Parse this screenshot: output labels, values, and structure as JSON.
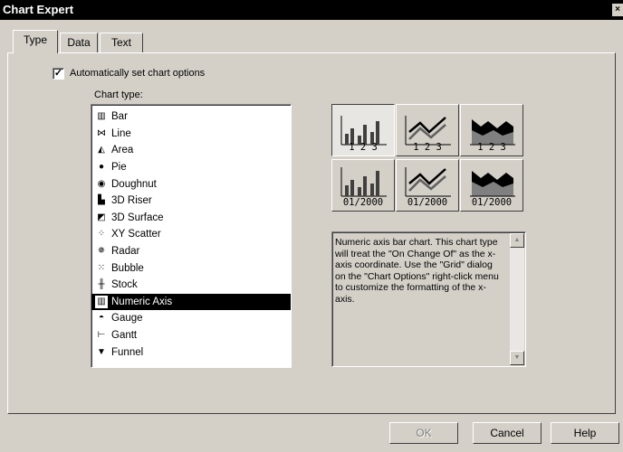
{
  "window": {
    "title": "Chart Expert",
    "close_glyph": "×"
  },
  "tabs": [
    {
      "label": "Type",
      "active": true
    },
    {
      "label": "Data",
      "active": false
    },
    {
      "label": "Text",
      "active": false
    }
  ],
  "auto_options": {
    "label": "Automatically set chart options",
    "checked": true,
    "check_glyph": "✓"
  },
  "chart_type_label": "Chart type:",
  "chart_types": [
    {
      "label": "Bar",
      "icon": "bar-chart-icon",
      "glyph": "▥"
    },
    {
      "label": "Line",
      "icon": "line-chart-icon",
      "glyph": "⋈"
    },
    {
      "label": "Area",
      "icon": "area-chart-icon",
      "glyph": "◭"
    },
    {
      "label": "Pie",
      "icon": "pie-chart-icon",
      "glyph": "●"
    },
    {
      "label": "Doughnut",
      "icon": "doughnut-chart-icon",
      "glyph": "◉"
    },
    {
      "label": "3D Riser",
      "icon": "3d-riser-icon",
      "glyph": "▙"
    },
    {
      "label": "3D Surface",
      "icon": "3d-surface-icon",
      "glyph": "◩"
    },
    {
      "label": "XY Scatter",
      "icon": "xy-scatter-icon",
      "glyph": "⁘"
    },
    {
      "label": "Radar",
      "icon": "radar-chart-icon",
      "glyph": "✵"
    },
    {
      "label": "Bubble",
      "icon": "bubble-chart-icon",
      "glyph": "⁙"
    },
    {
      "label": "Stock",
      "icon": "stock-chart-icon",
      "glyph": "╫"
    },
    {
      "label": "Numeric Axis",
      "icon": "numeric-axis-icon",
      "glyph": "▥",
      "selected": true
    },
    {
      "label": "Gauge",
      "icon": "gauge-chart-icon",
      "glyph": "◓"
    },
    {
      "label": "Gantt",
      "icon": "gantt-chart-icon",
      "glyph": "⊢"
    },
    {
      "label": "Funnel",
      "icon": "funnel-chart-icon",
      "glyph": "▼"
    }
  ],
  "subtypes": [
    {
      "name": "bar",
      "label": "1 2 3",
      "selected": true
    },
    {
      "name": "line",
      "label": "1 2 3",
      "selected": false
    },
    {
      "name": "area",
      "label": "1 2 3",
      "selected": false
    },
    {
      "name": "bar",
      "label": "01/2000",
      "selected": false
    },
    {
      "name": "line",
      "label": "01/2000",
      "selected": false
    },
    {
      "name": "area",
      "label": "01/2000",
      "selected": false
    }
  ],
  "description": "Numeric axis bar chart.  This chart type will treat the \"On Change Of\" as the x-axis coordinate.  Use the \"Grid\" dialog on the \"Chart Options\" right-click menu to customize the formatting of the x-axis.",
  "scroll_up_glyph": "▲",
  "scroll_down_glyph": "▼",
  "buttons": {
    "ok": "OK",
    "cancel": "Cancel",
    "help": "Help"
  }
}
